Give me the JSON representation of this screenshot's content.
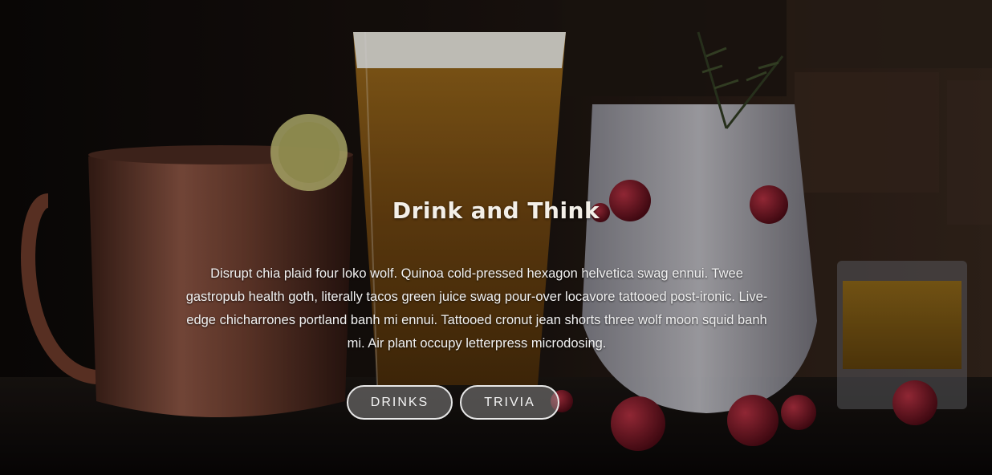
{
  "hero": {
    "title": "Drink and Think",
    "description": "Disrupt chia plaid four loko wolf. Quinoa cold-pressed hexagon helvetica swag ennui. Twee gastropub health goth, literally tacos green juice swag pour-over locavore tattooed post-ironic. Live-edge chicharrones portland banh mi ennui. Tattooed cronut jean shorts three wolf moon squid banh mi. Air plant occupy letterpress microdosing.",
    "buttons": {
      "drinks": "DRINKS",
      "trivia": "TRIVIA"
    }
  }
}
